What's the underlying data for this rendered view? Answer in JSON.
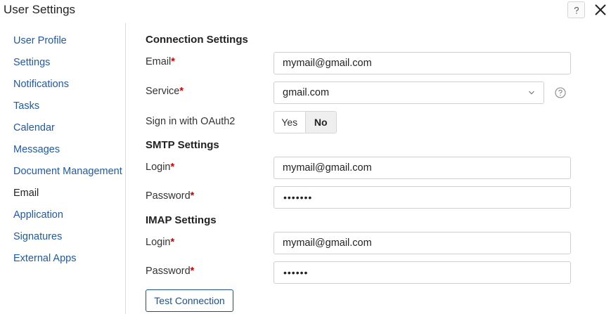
{
  "window": {
    "title": "User Settings"
  },
  "sidebar": {
    "items": [
      {
        "label": "User Profile",
        "active": false
      },
      {
        "label": "Settings",
        "active": false
      },
      {
        "label": "Notifications",
        "active": false
      },
      {
        "label": "Tasks",
        "active": false
      },
      {
        "label": "Calendar",
        "active": false
      },
      {
        "label": "Messages",
        "active": false
      },
      {
        "label": "Document Management",
        "active": false
      },
      {
        "label": "Email",
        "active": true
      },
      {
        "label": "Application",
        "active": false
      },
      {
        "label": "Signatures",
        "active": false
      },
      {
        "label": "External Apps",
        "active": false
      }
    ]
  },
  "connection": {
    "heading": "Connection Settings",
    "email_label": "Email",
    "email_value": "mymail@gmail.com",
    "service_label": "Service",
    "service_value": "gmail.com",
    "oauth_label": "Sign in with OAuth2",
    "oauth_yes": "Yes",
    "oauth_no": "No",
    "oauth_selected": "No"
  },
  "smtp": {
    "heading": "SMTP Settings",
    "login_label": "Login",
    "login_value": "mymail@gmail.com",
    "password_label": "Password",
    "password_mask": "•••••••"
  },
  "imap": {
    "heading": "IMAP Settings",
    "login_label": "Login",
    "login_value": "mymail@gmail.com",
    "password_label": "Password",
    "password_mask": "••••••"
  },
  "actions": {
    "test_label": "Test Connection"
  },
  "required_mark": "*",
  "colors": {
    "link": "#1f5aa6",
    "required": "#cc0000",
    "button_border": "#1f4f8a"
  }
}
